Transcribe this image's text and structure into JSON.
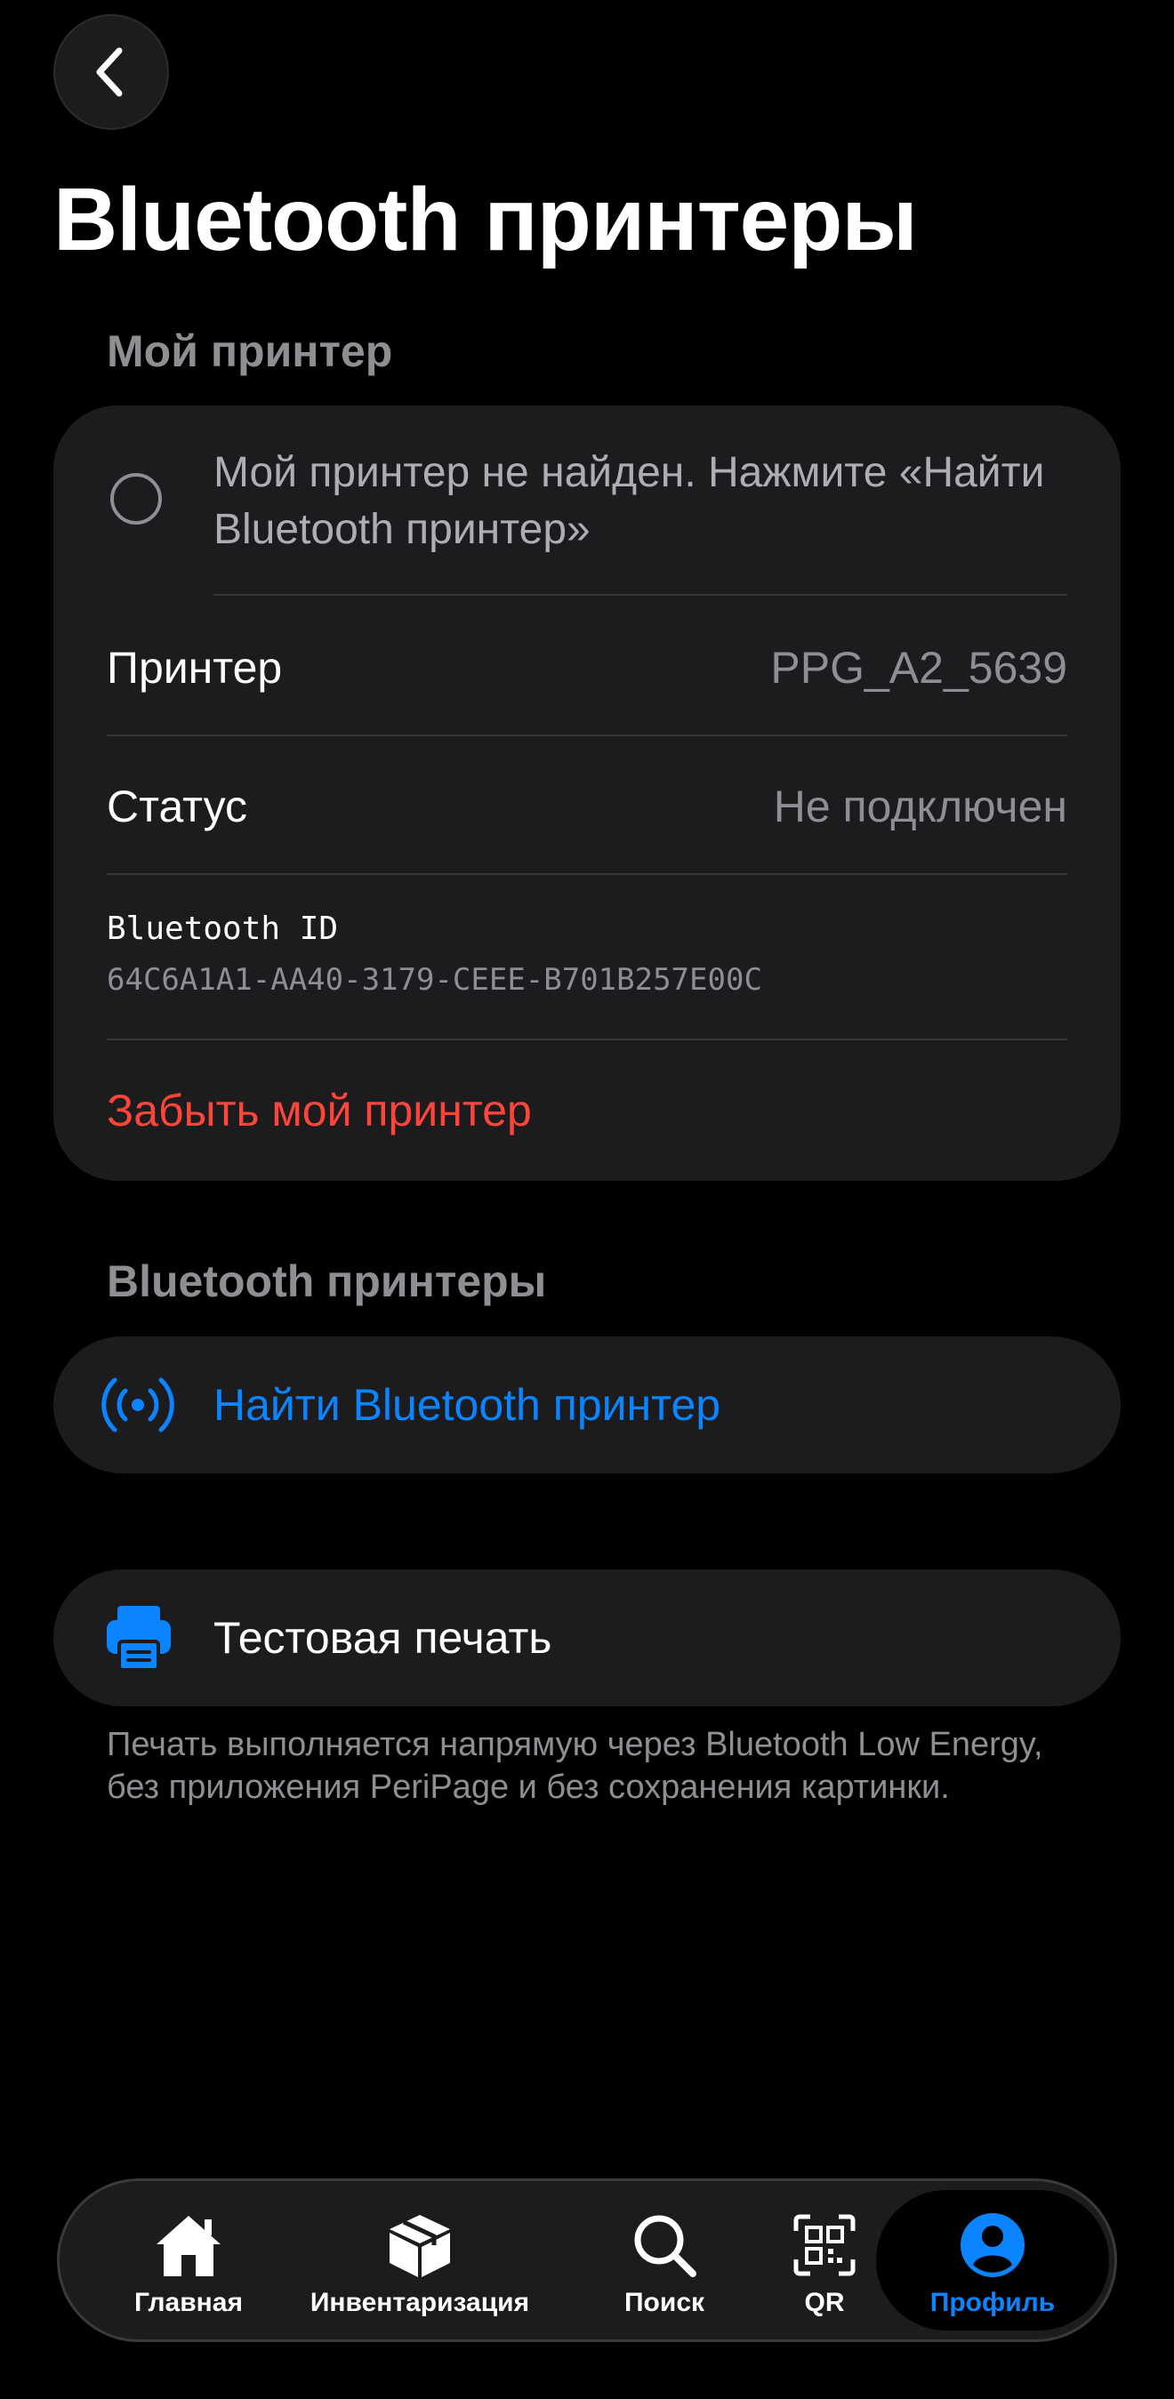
{
  "header": {
    "title": "Bluetooth принтеры"
  },
  "my_printer": {
    "section_label": "Мой принтер",
    "not_found_text": "Мой принтер не найден. Нажмите «Найти Bluetooth принтер»",
    "printer_label": "Принтер",
    "printer_value": "PPG_A2_5639",
    "status_label": "Статус",
    "status_value": "Не подключен",
    "bluetooth_id_label": "Bluetooth ID",
    "bluetooth_id_value": "64C6A1A1-AA40-3179-CEEE-B701B257E00C",
    "forget_label": "Забыть мой принтер"
  },
  "bluetooth_printers": {
    "section_label": "Bluetooth принтеры",
    "find_label": "Найти Bluetooth принтер",
    "test_print_label": "Тестовая печать",
    "footnote": "Печать выполняется напрямую через Bluetooth Low Energy, без приложения PeriPage и без сохранения картинки."
  },
  "tabbar": {
    "items": [
      {
        "label": "Главная",
        "icon": "home-icon"
      },
      {
        "label": "Инвентаризация",
        "icon": "box-icon"
      },
      {
        "label": "Поиск",
        "icon": "search-icon"
      },
      {
        "label": "QR",
        "icon": "qr-icon"
      },
      {
        "label": "Профиль",
        "icon": "profile-icon",
        "active": true
      }
    ]
  },
  "colors": {
    "accent": "#0a84ff",
    "destructive": "#ff453a",
    "card": "#1c1c1e",
    "secondary_text": "#8e8e93"
  }
}
